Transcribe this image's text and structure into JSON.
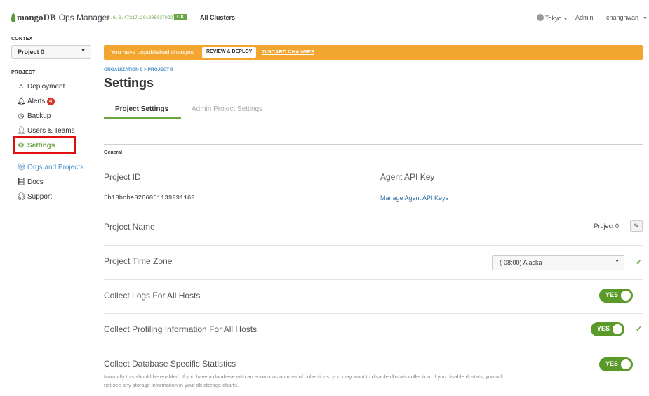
{
  "topbar": {
    "logo_brand": "mongoDB",
    "logo_app": "Ops Manager",
    "version": "3.6.6.47217.20180503T0927Z",
    "status": "OK",
    "clusters_link": "All Clusters",
    "region": "Tokyo",
    "admin": "Admin",
    "user": "changhwan"
  },
  "sidebar": {
    "context_label": "CONTEXT",
    "context_value": "Project 0",
    "project_label": "PROJECT",
    "items": [
      {
        "label": "Deployment",
        "icon": "deployment-icon"
      },
      {
        "label": "Alerts",
        "icon": "bell-icon",
        "badge": "4"
      },
      {
        "label": "Backup",
        "icon": "backup-clock-icon"
      },
      {
        "label": "Users & Teams",
        "icon": "user-icon"
      },
      {
        "label": "Settings",
        "icon": "gear-icon",
        "active": true
      }
    ],
    "links": [
      {
        "label": "Orgs and Projects",
        "icon": "gift-icon"
      },
      {
        "label": "Docs",
        "icon": "book-icon"
      },
      {
        "label": "Support",
        "icon": "headset-icon"
      }
    ]
  },
  "banner": {
    "text": "You have unpublished changes",
    "review_label": "REVIEW & DEPLOY",
    "discard_label": "DISCARD CHANGES"
  },
  "breadcrumb": "ORGANIZATION 0 > PROJECT 0",
  "page_title": "Settings",
  "tabs": [
    {
      "label": "Project Settings",
      "active": true
    },
    {
      "label": "Admin Project Settings",
      "active": false
    }
  ],
  "general": {
    "section_label": "General",
    "project_id_label": "Project ID",
    "project_id_value": "5b18bcbe8266061139991169",
    "agent_api_label": "Agent API Key",
    "agent_api_link": "Manage Agent API Keys",
    "project_name_label": "Project Name",
    "project_name_value": "Project 0",
    "timezone_label": "Project Time Zone",
    "timezone_value": "(-08:00) Alaska",
    "collect_logs_label": "Collect Logs For All Hosts",
    "collect_logs_value": "YES",
    "profiling_label": "Collect Profiling Information For All Hosts",
    "profiling_value": "YES",
    "dbstats_label": "Collect Database Specific Statistics",
    "dbstats_value": "YES",
    "dbstats_desc": "Normally this should be enabled. If you have a database with an enormous number of collections, you may want to disable dbstats collection. If you disable dbstats, you will not see any storage information in your db storage charts."
  },
  "colors": {
    "accent_green": "#6ba543",
    "banner_orange": "#f2a630",
    "link_blue": "#4a90c8",
    "highlight_red": "#e01010"
  }
}
